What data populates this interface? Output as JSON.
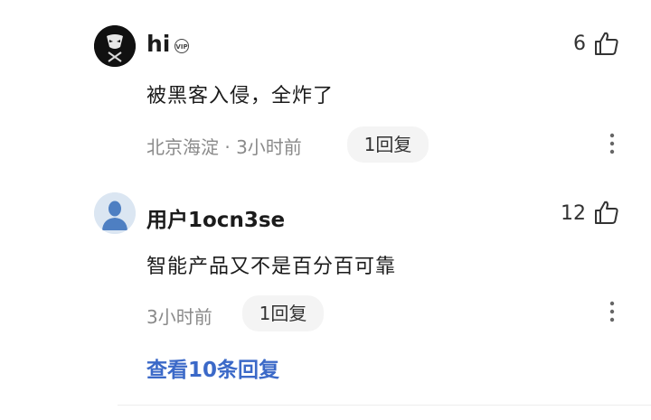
{
  "comments": [
    {
      "username": "hi",
      "badge": "VIP",
      "text": "被黑客入侵，全炸了",
      "meta": "北京海淀 · 3小时前",
      "reply_label": "1回复",
      "likes": "6"
    },
    {
      "username": "用户1ocn3se",
      "text": "智能产品又不是百分百可靠",
      "meta": "3小时前",
      "reply_label": "1回复",
      "likes": "12"
    }
  ],
  "view_replies": "查看10条回复",
  "colors": {
    "link": "#3b69c8",
    "muted": "#8a8a8a"
  }
}
